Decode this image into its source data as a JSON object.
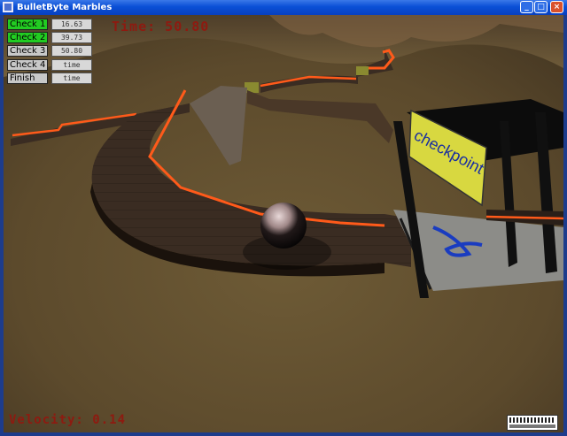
{
  "window": {
    "title": "BulletByte Marbles",
    "controls": [
      "_",
      "□",
      "×"
    ]
  },
  "checkpoints": [
    {
      "label": "Check 1",
      "time": "16.63",
      "status": "passed",
      "color": "#22cc22"
    },
    {
      "label": "Check 2",
      "time": "39.73",
      "status": "passed",
      "color": "#22cc22"
    },
    {
      "label": "Check 3",
      "time": "50.80",
      "status": "pending",
      "color": "#c8c8c8"
    },
    {
      "label": "Check 4",
      "time": "time",
      "status": "pending",
      "color": "#c8c8c8"
    },
    {
      "label": "Finish",
      "time": "time",
      "status": "pending",
      "color": "#c8c8c8"
    }
  ],
  "hud": {
    "timer": "Time: 50.80",
    "velocity": "Velocity: 0.14",
    "text_color": "#8e1a10"
  },
  "scene": {
    "banner_text": "checkpoint",
    "track_line_color": "#ff5a1a",
    "banner_color": "#d8d840"
  },
  "icons": [
    "app-icon",
    "minimize-icon",
    "maximize-icon",
    "close-icon",
    "marble",
    "engine-logo"
  ]
}
